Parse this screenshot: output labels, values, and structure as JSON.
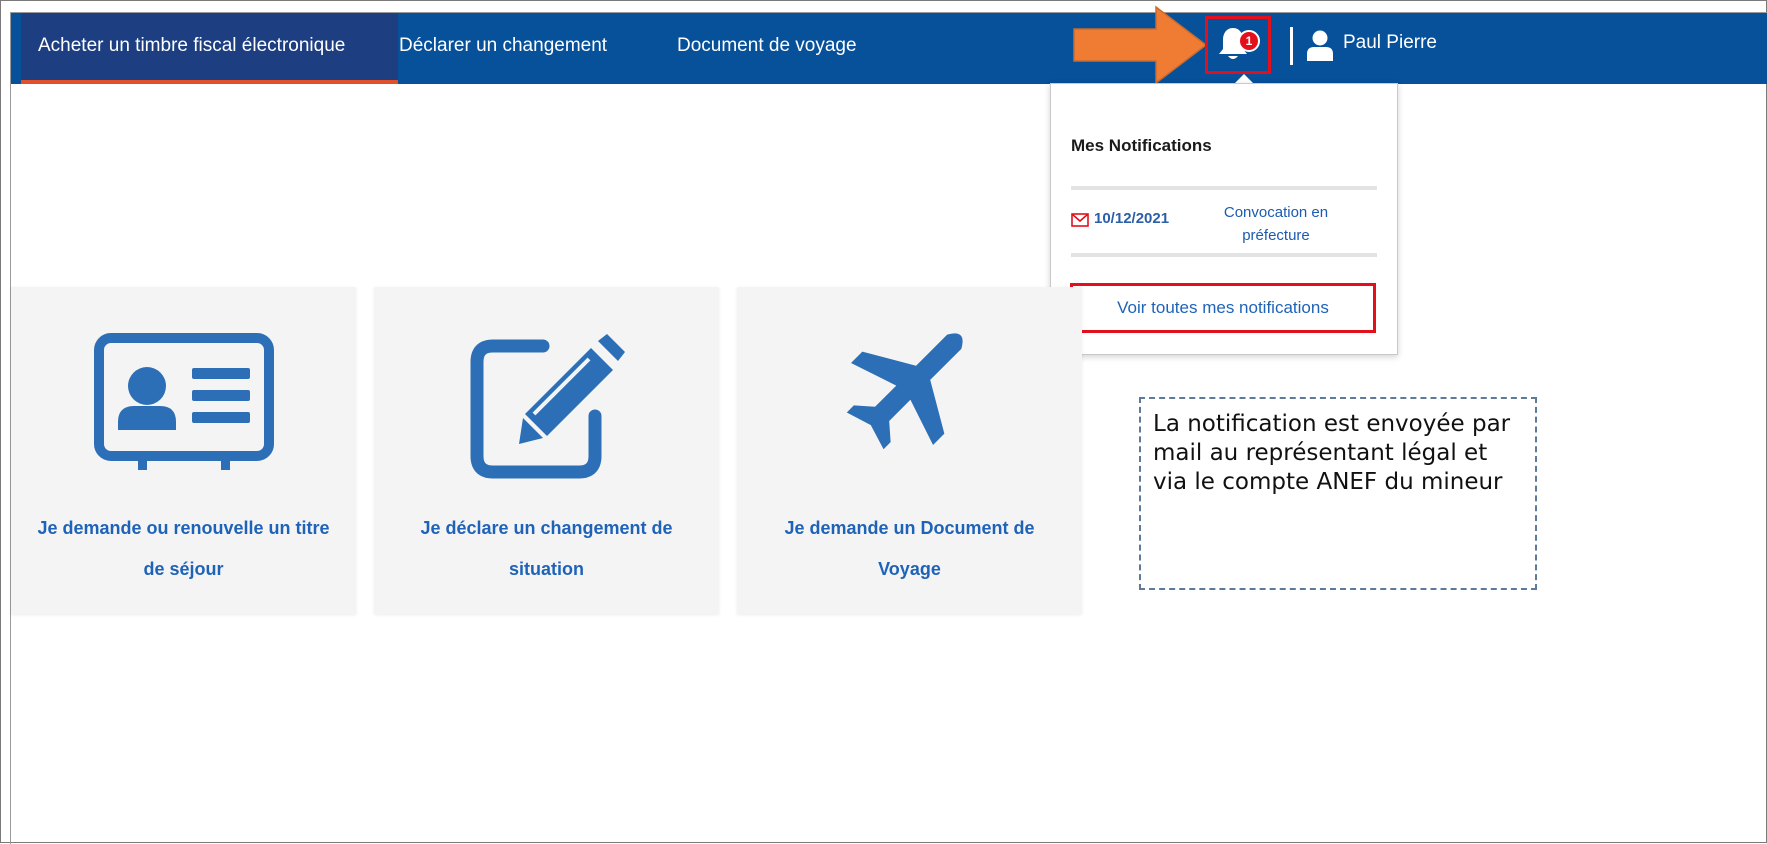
{
  "nav": {
    "items": [
      {
        "label": "Acheter un timbre fiscal électronique"
      },
      {
        "label": "Déclarer un changement"
      },
      {
        "label": "Document de voyage"
      }
    ],
    "badge_count": "1",
    "user_name": "Paul Pierre"
  },
  "notifications": {
    "title": "Mes Notifications",
    "items": [
      {
        "date": "10/12/2021",
        "text": "Convocation en préfecture"
      }
    ],
    "see_all": "Voir toutes mes notifications"
  },
  "cards": [
    {
      "icon": "id-card-icon",
      "line1": "Je demande ou renouvelle un titre",
      "line2": "de séjour"
    },
    {
      "icon": "pencil-edit-icon",
      "line1": "Je déclare un changement de",
      "line2": "situation"
    },
    {
      "icon": "airplane-icon",
      "line1": "Je demande un Document de",
      "line2": "Voyage"
    }
  ],
  "callout": {
    "text": "La notification est envoyée par mail au représentant légal et via le compte ANEF du mineur"
  },
  "colors": {
    "navbar": "#07509a",
    "active_tab": "#1d3e80",
    "active_underline": "#e2502b",
    "arrow": "#f07c34",
    "highlight_box": "#e3101b",
    "link_blue": "#1f63b9",
    "icon_blue": "#2d6fb7"
  }
}
